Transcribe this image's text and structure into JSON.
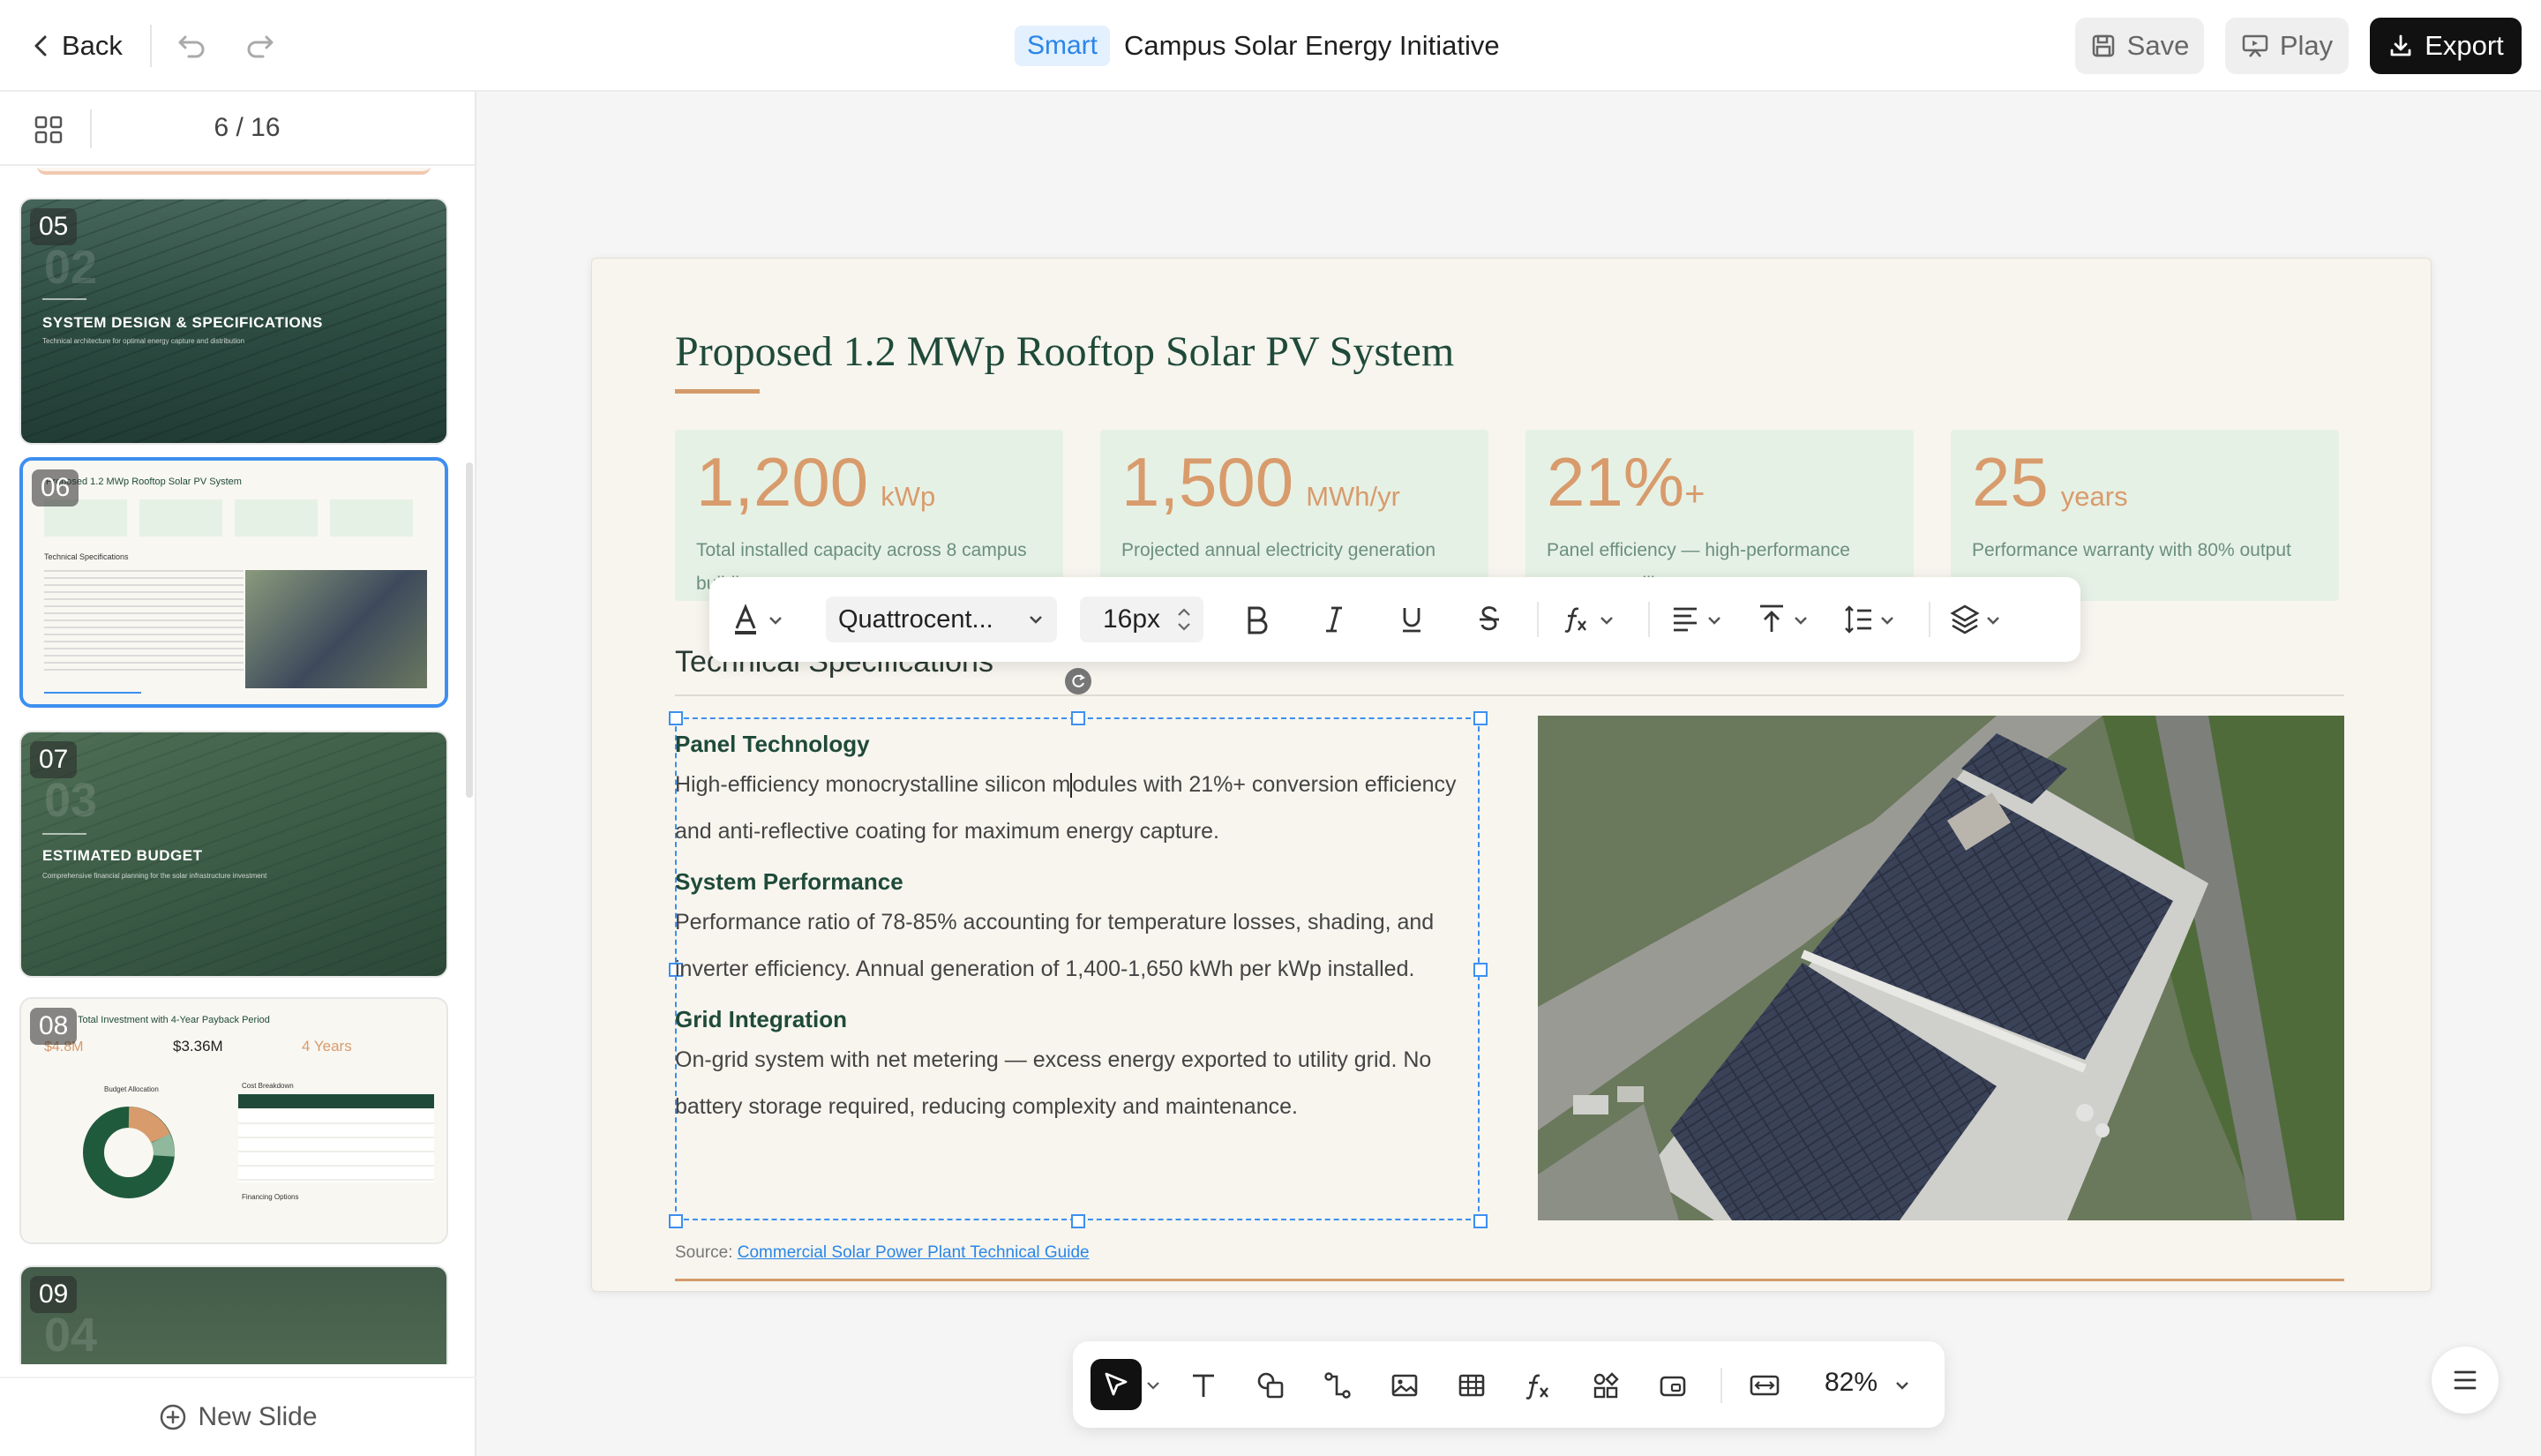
{
  "header": {
    "back_label": "Back",
    "smart_badge": "Smart",
    "title": "Campus Solar Energy Initiative",
    "save_label": "Save",
    "play_label": "Play",
    "export_label": "Export"
  },
  "sidebar": {
    "page_counter": "6 / 16",
    "new_slide_label": "New Slide",
    "thumbnails": [
      {
        "num": "05",
        "ghost": "02",
        "title": "SYSTEM DESIGN & SPECIFICATIONS",
        "subtitle": "Technical architecture for optimal energy capture and distribution"
      },
      {
        "num": "06",
        "title": "Proposed 1.2 MWp Rooftop Solar PV System",
        "label": "Technical Specifications"
      },
      {
        "num": "07",
        "ghost": "03",
        "title": "ESTIMATED BUDGET",
        "subtitle": "Comprehensive financial planning for the solar infrastructure investment"
      },
      {
        "num": "08",
        "title": "Total Investment with 4-Year Payback Period",
        "stat1": "$4.8M",
        "stat2": "$3.36M",
        "stat3": "4 Years",
        "chart_title": "Budget Allocation",
        "table_title": "Cost Breakdown",
        "options_title": "Financing Options"
      },
      {
        "num": "09",
        "ghost": "04"
      }
    ]
  },
  "slide": {
    "title": "Proposed 1.2 MWp Rooftop Solar PV System",
    "stats": [
      {
        "value": "1,200",
        "unit": "kWp",
        "desc": "Total installed capacity across 8 campus buildings"
      },
      {
        "value": "1,500",
        "unit": "MWh/yr",
        "desc": "Projected annual electricity generation"
      },
      {
        "value": "21%",
        "unit": "+",
        "desc": "Panel efficiency — high-performance monocrystalline"
      },
      {
        "value": "25",
        "unit": "years",
        "desc": "Performance warranty with 80% output guarantee"
      }
    ],
    "spec_heading": "Technical Specifications",
    "sections": [
      {
        "heading": "Panel Technology",
        "body_a": "High-efficiency monocrystalline silicon m",
        "body_b": "odules with 21%+ conversion efficiency and anti-reflective coating for maximum energy capture."
      },
      {
        "heading": "System Performance",
        "body": "Performance ratio of 78-85% accounting for temperature losses, shading, and inverter efficiency. Annual generation of 1,400-1,650 kWh per kWp installed."
      },
      {
        "heading": "Grid Integration",
        "body": "On-grid system with net metering — excess energy exported to utility grid. No battery storage required, reducing complexity and maintenance."
      }
    ],
    "source_prefix": "Source: ",
    "source_link": "Commercial Solar Power Plant Technical Guide"
  },
  "text_toolbar": {
    "font": "Quattrocent...",
    "size": "16px"
  },
  "dock": {
    "zoom": "82%"
  },
  "colors": {
    "accent": "#3d8ff0",
    "slide_green": "#1f4a3a",
    "stat_orange": "#d89b6c",
    "stat_bg": "#e6f1e5"
  }
}
